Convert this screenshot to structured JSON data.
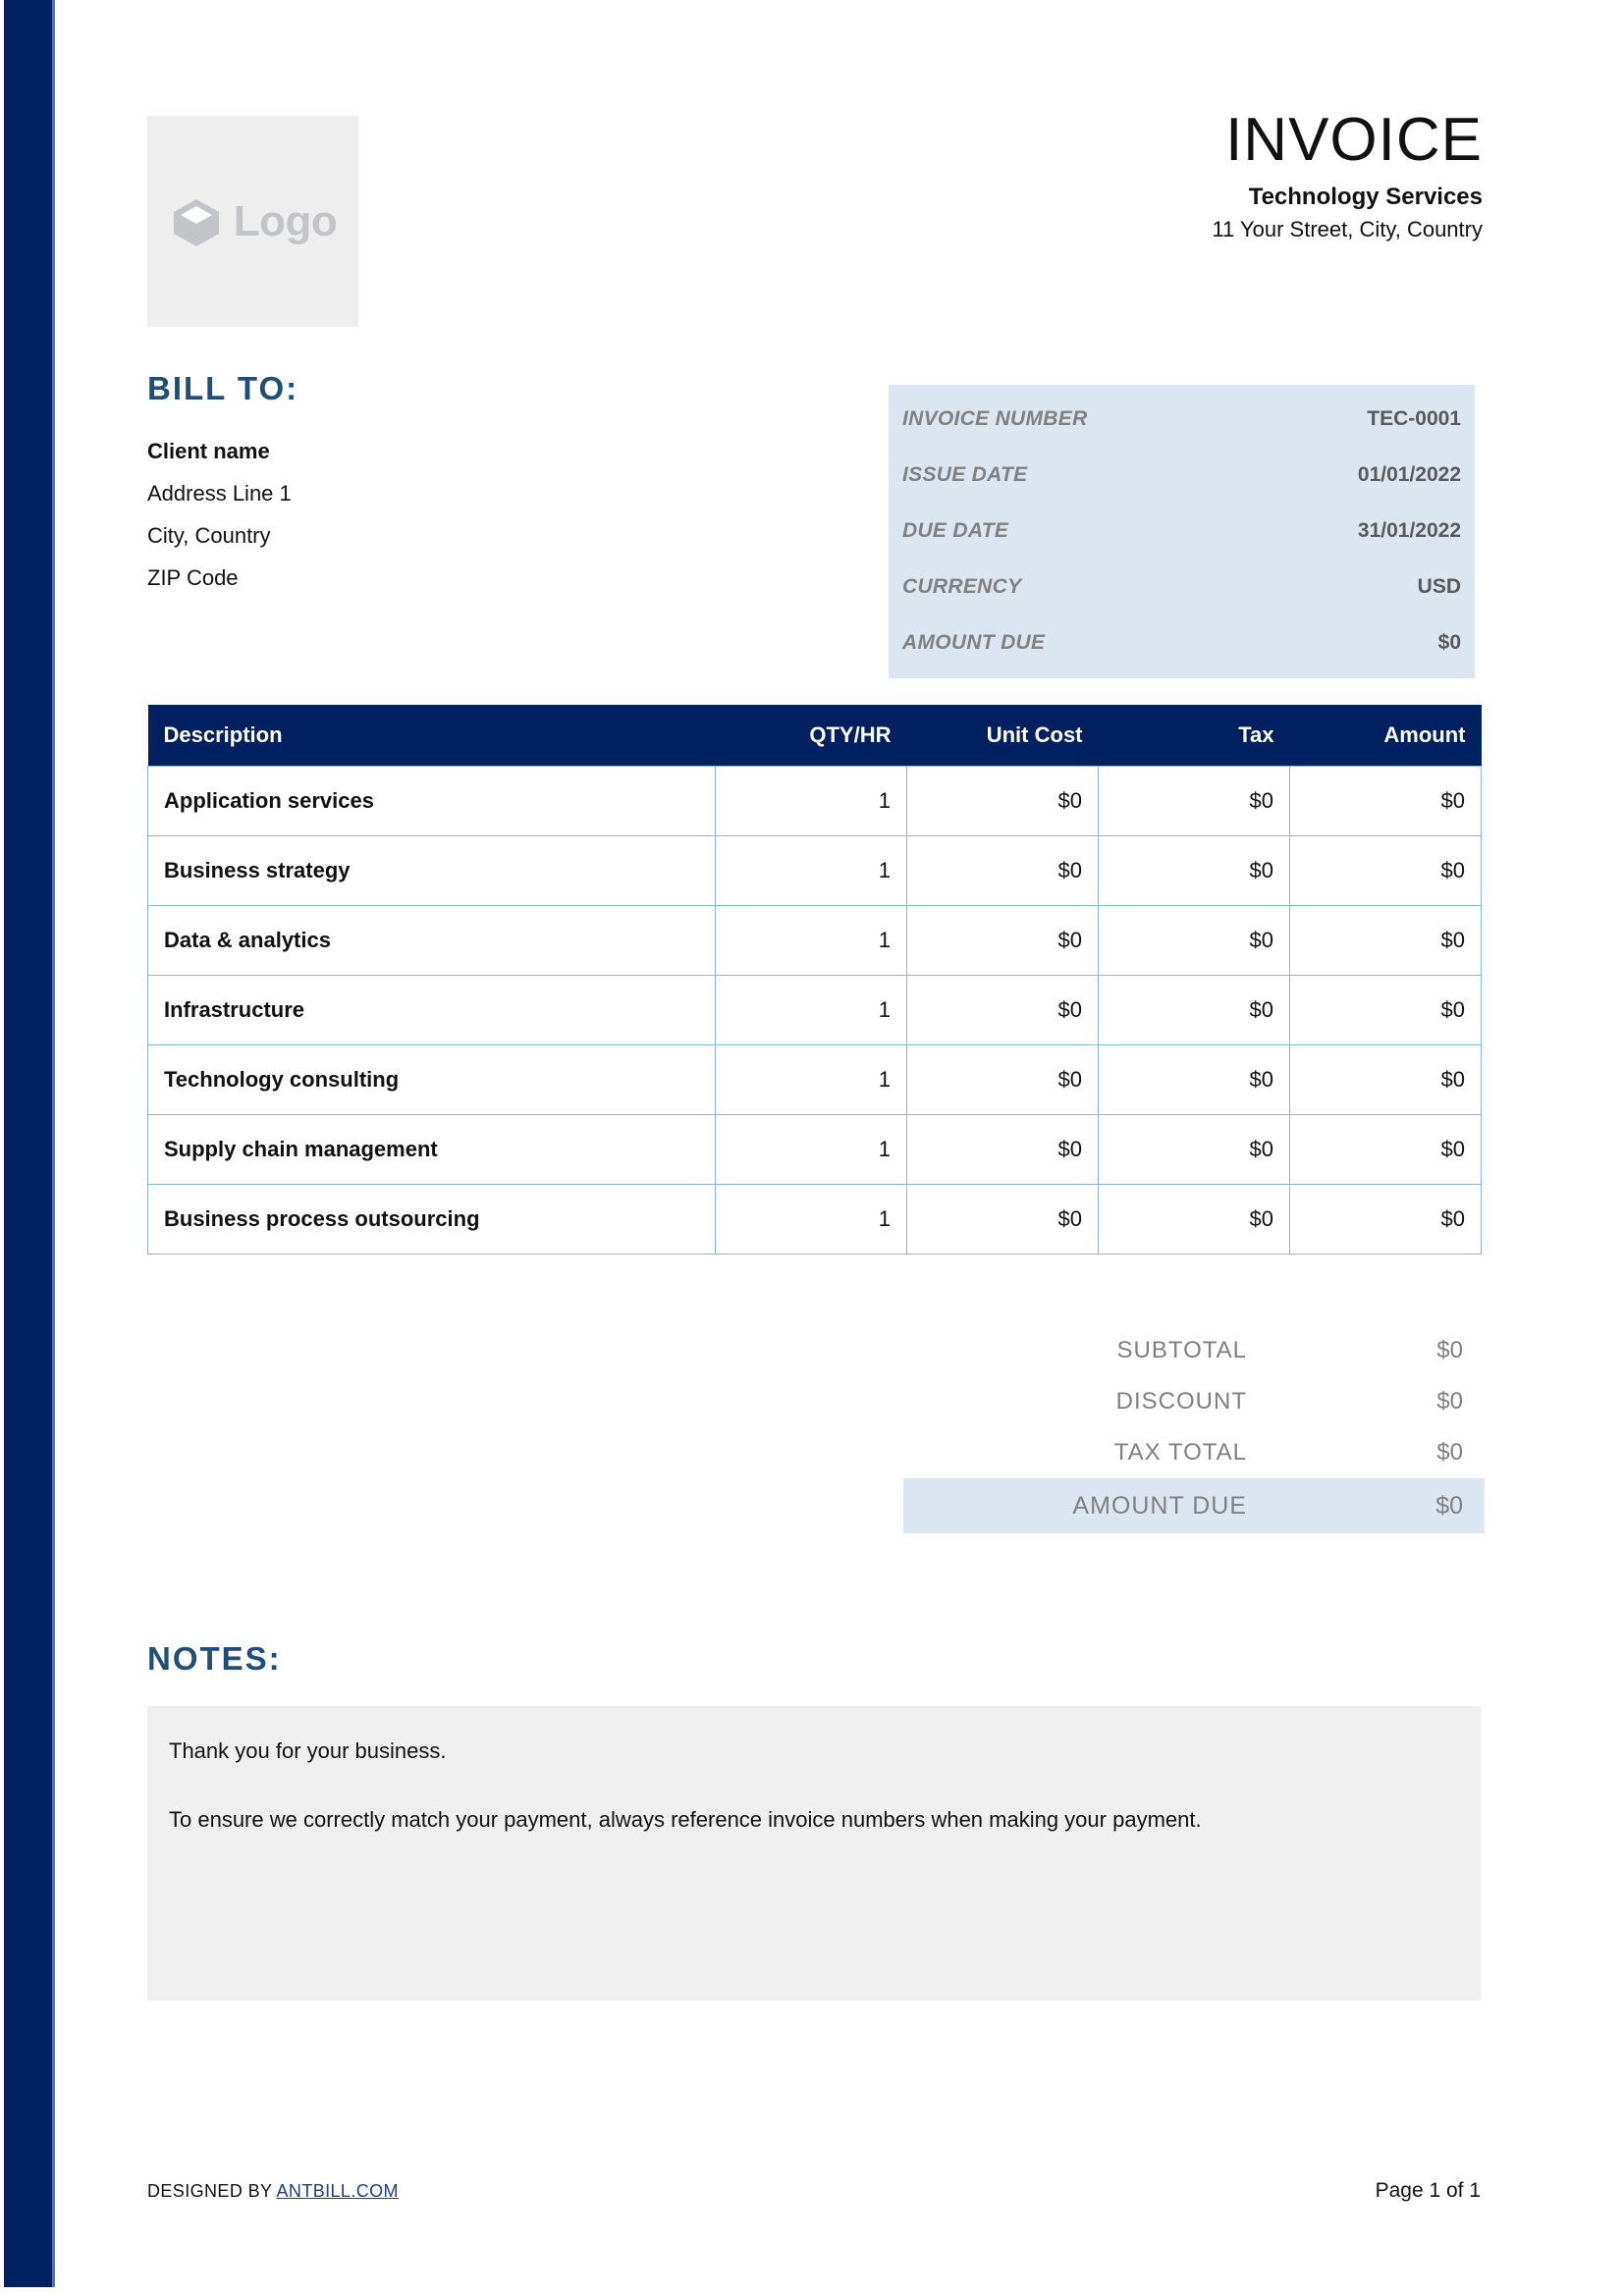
{
  "theme": {
    "navy": "#002060",
    "heading_blue": "#1f4e79",
    "pale_blue": "#dce6f1",
    "table_border": "#8db3d9",
    "notes_gray": "#efefef",
    "logo_gray": "#c2c4c8"
  },
  "logo": {
    "icon": "cube-icon",
    "text": "Logo"
  },
  "header": {
    "doc_title": "INVOICE",
    "company_name": "Technology Services",
    "company_address": "11 Your Street, City, Country"
  },
  "bill_to": {
    "heading": "BILL TO:",
    "lines": [
      "Client name",
      "Address Line 1",
      "City, Country",
      "ZIP Code"
    ]
  },
  "invoice_details": [
    {
      "label": "INVOICE NUMBER",
      "value": "TEC-0001"
    },
    {
      "label": "ISSUE DATE",
      "value": "01/01/2022"
    },
    {
      "label": "DUE DATE",
      "value": "31/01/2022"
    },
    {
      "label": "CURRENCY",
      "value": "USD"
    },
    {
      "label": "AMOUNT DUE",
      "value": "$0"
    }
  ],
  "items_table": {
    "columns": [
      "Description",
      "QTY/HR",
      "Unit Cost",
      "Tax",
      "Amount"
    ],
    "rows": [
      {
        "description": "Application services",
        "qty": "1",
        "unit_cost": "$0",
        "tax": "$0",
        "amount": "$0"
      },
      {
        "description": "Business strategy",
        "qty": "1",
        "unit_cost": "$0",
        "tax": "$0",
        "amount": "$0"
      },
      {
        "description": "Data & analytics",
        "qty": "1",
        "unit_cost": "$0",
        "tax": "$0",
        "amount": "$0"
      },
      {
        "description": "Infrastructure",
        "qty": "1",
        "unit_cost": "$0",
        "tax": "$0",
        "amount": "$0"
      },
      {
        "description": "Technology consulting",
        "qty": "1",
        "unit_cost": "$0",
        "tax": "$0",
        "amount": "$0"
      },
      {
        "description": "Supply chain management",
        "qty": "1",
        "unit_cost": "$0",
        "tax": "$0",
        "amount": "$0"
      },
      {
        "description": "Business process outsourcing",
        "qty": "1",
        "unit_cost": "$0",
        "tax": "$0",
        "amount": "$0"
      }
    ]
  },
  "totals": [
    {
      "label": "SUBTOTAL",
      "value": "$0",
      "highlight": false
    },
    {
      "label": "DISCOUNT",
      "value": "$0",
      "highlight": false
    },
    {
      "label": "TAX TOTAL",
      "value": "$0",
      "highlight": false
    },
    {
      "label": "AMOUNT DUE",
      "value": "$0",
      "highlight": true
    }
  ],
  "notes": {
    "heading": "NOTES:",
    "paragraphs": [
      "Thank you for your business.",
      "To ensure we correctly match your payment, always reference invoice numbers when making your payment."
    ]
  },
  "footer": {
    "designed_by_prefix": "DESIGNED BY ",
    "designed_by_link": "ANTBILL.COM",
    "page_label": "Page 1 of 1"
  }
}
